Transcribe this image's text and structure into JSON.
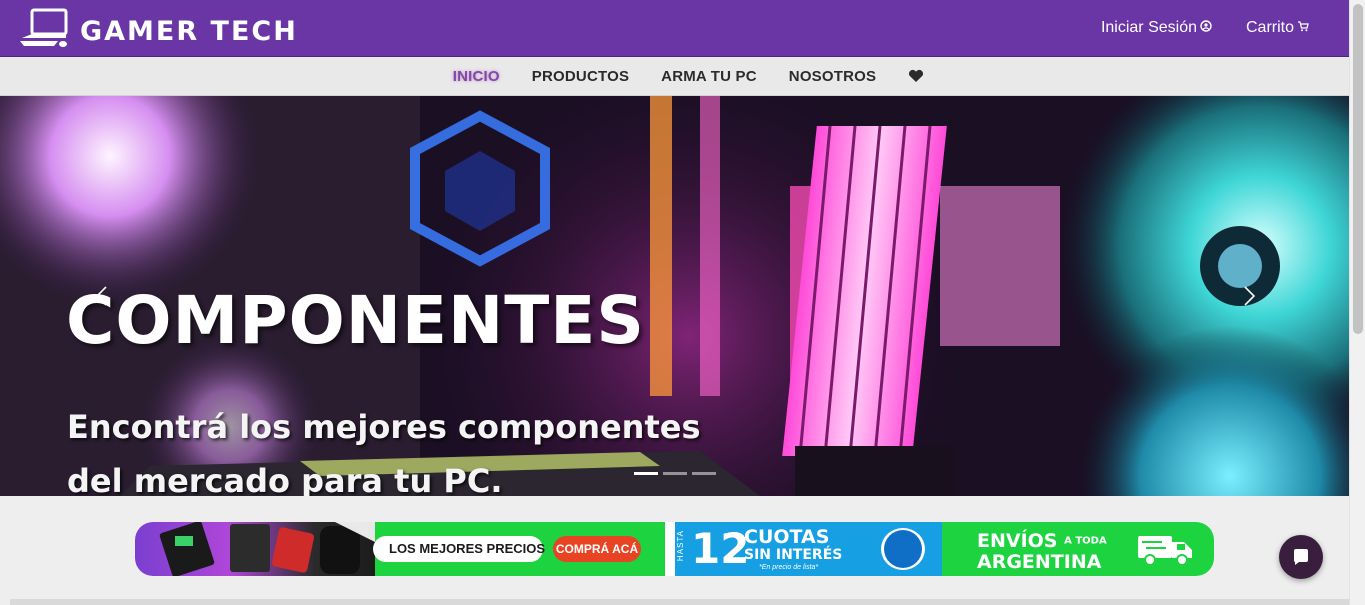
{
  "header": {
    "brand": "GAMER TECH",
    "logo_icon": "computer-icon",
    "links": [
      {
        "label": "Iniciar Sesión",
        "icon": "user-circle-icon"
      },
      {
        "label": "Carrito",
        "icon": "cart-icon"
      }
    ],
    "colors": {
      "bar": "#6a35a5"
    }
  },
  "nav": {
    "items": [
      {
        "label": "INICIO",
        "active": true
      },
      {
        "label": "PRODUCTOS",
        "active": false
      },
      {
        "label": "ARMA TU PC",
        "active": false
      },
      {
        "label": "NOSOTROS",
        "active": false
      }
    ],
    "favorites_icon": "heart-icon"
  },
  "carousel": {
    "title": "COMPONENTES",
    "subtitle": "Encontrá los mejores componentes del mercado para tu PC.",
    "slide_count": 3,
    "active_slide": 1,
    "prev_icon": "chevron-left-icon",
    "next_icon": "chevron-right-icon"
  },
  "promo": {
    "text1": "LOS MEJORES PRECIOS",
    "cta": "COMPRÁ ACÁ",
    "hasta": "HASTA",
    "cuotas_number": "12",
    "cuotas_line1": "CUOTAS",
    "cuotas_line2": "SIN INTERÉS",
    "cuotas_note": "*En precio de lista*",
    "envios_line1": "ENVÍOS",
    "envios_small": "A TODA",
    "envios_line2": "ARGENTINA",
    "truck_icon": "truck-icon"
  },
  "chat": {
    "icon": "chat-bubble-icon"
  }
}
